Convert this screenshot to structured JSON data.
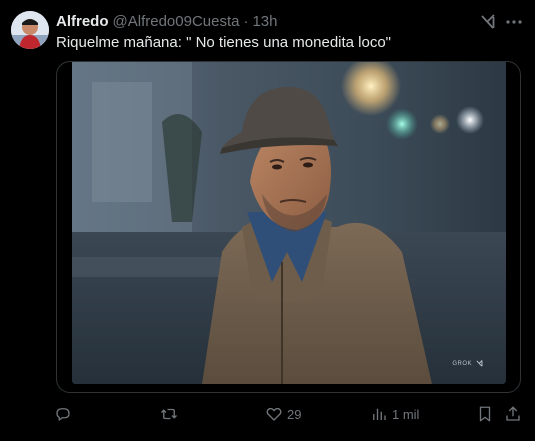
{
  "author": {
    "display_name": "Alfredo",
    "handle": "@Alfredo09Cuesta",
    "separator": "·",
    "time": "13h"
  },
  "tweet": {
    "text": "Riquelme mañana: \" No tienes una monedita loco\""
  },
  "media": {
    "badge_text": "GROK",
    "description_icon": "grok-logo-icon"
  },
  "actions": {
    "reply_count": "",
    "retweet_count": "",
    "like_count": "29",
    "views_count": "1 mil"
  },
  "colors": {
    "background": "#000000",
    "primary_text": "#e7e9ea",
    "secondary_text": "#71767b",
    "border": "#2f3336"
  },
  "icons": {
    "grok": "grok-icon",
    "more": "more-icon",
    "reply": "reply-icon",
    "retweet": "retweet-icon",
    "like": "heart-icon",
    "views": "views-icon",
    "bookmark": "bookmark-icon",
    "share": "share-icon"
  }
}
